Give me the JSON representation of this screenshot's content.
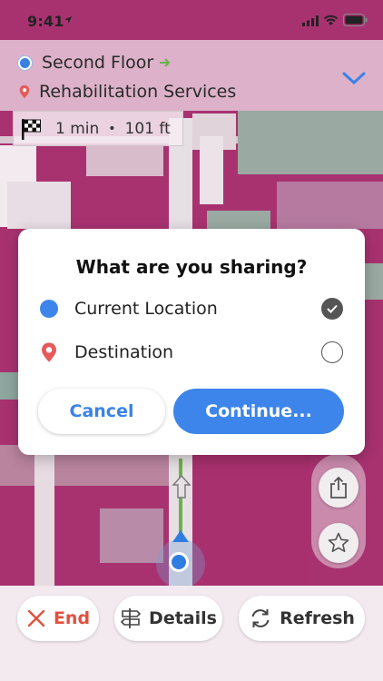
{
  "status_bar": {
    "time": "9:41"
  },
  "header": {
    "floor": "Second Floor",
    "destination": "Rehabilitation Services"
  },
  "eta": {
    "time": "1 min",
    "separator": "•",
    "distance": "101 ft"
  },
  "dialog": {
    "title": "What are you sharing?",
    "options": [
      {
        "label": "Current Location",
        "selected": true
      },
      {
        "label": "Destination",
        "selected": false
      }
    ],
    "cancel_label": "Cancel",
    "continue_label": "Continue..."
  },
  "bottom_bar": {
    "end_label": "End",
    "details_label": "Details",
    "refresh_label": "Refresh"
  },
  "colors": {
    "accent": "#3d85ea",
    "end": "#e2503f",
    "map_room": "#a83270",
    "route": "#6bb24a"
  }
}
